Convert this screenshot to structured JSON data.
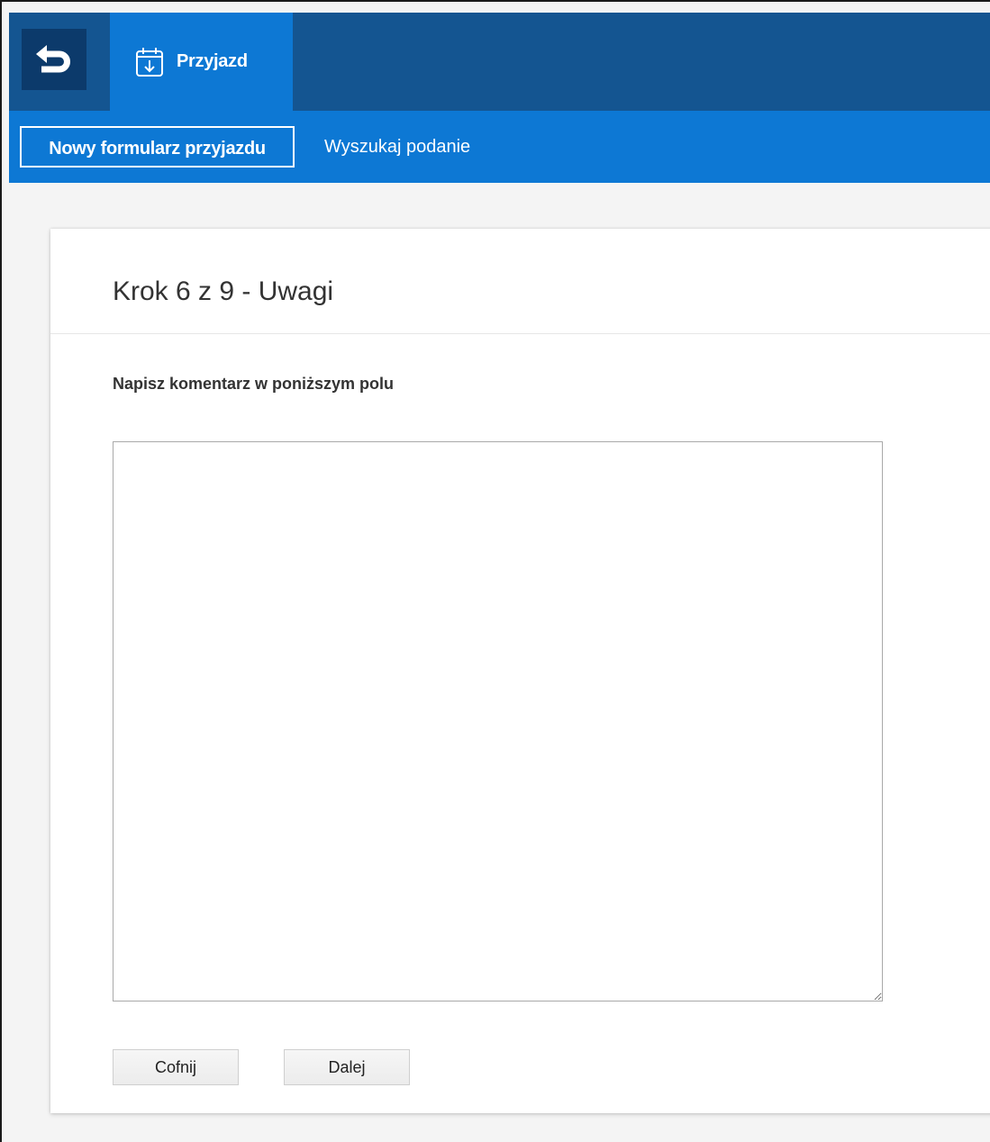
{
  "header": {
    "back_icon": "undo-arrow-icon",
    "app_tab": {
      "icon": "calendar-arrival-icon",
      "label": "Przyjazd"
    },
    "colors": {
      "topbar": "#145591",
      "accent": "#0d78d4",
      "back_button": "#0c3a6b"
    }
  },
  "subnav": {
    "items": [
      {
        "label": "Nowy formularz przyjazdu",
        "active": true
      },
      {
        "label": "Wyszukaj podanie",
        "active": false
      }
    ]
  },
  "form": {
    "step_title": "Krok 6 z 9 - Uwagi",
    "comment_label": "Napisz komentarz w poniższym polu",
    "comment_value": "",
    "back_button": "Cofnij",
    "next_button": "Dalej"
  }
}
